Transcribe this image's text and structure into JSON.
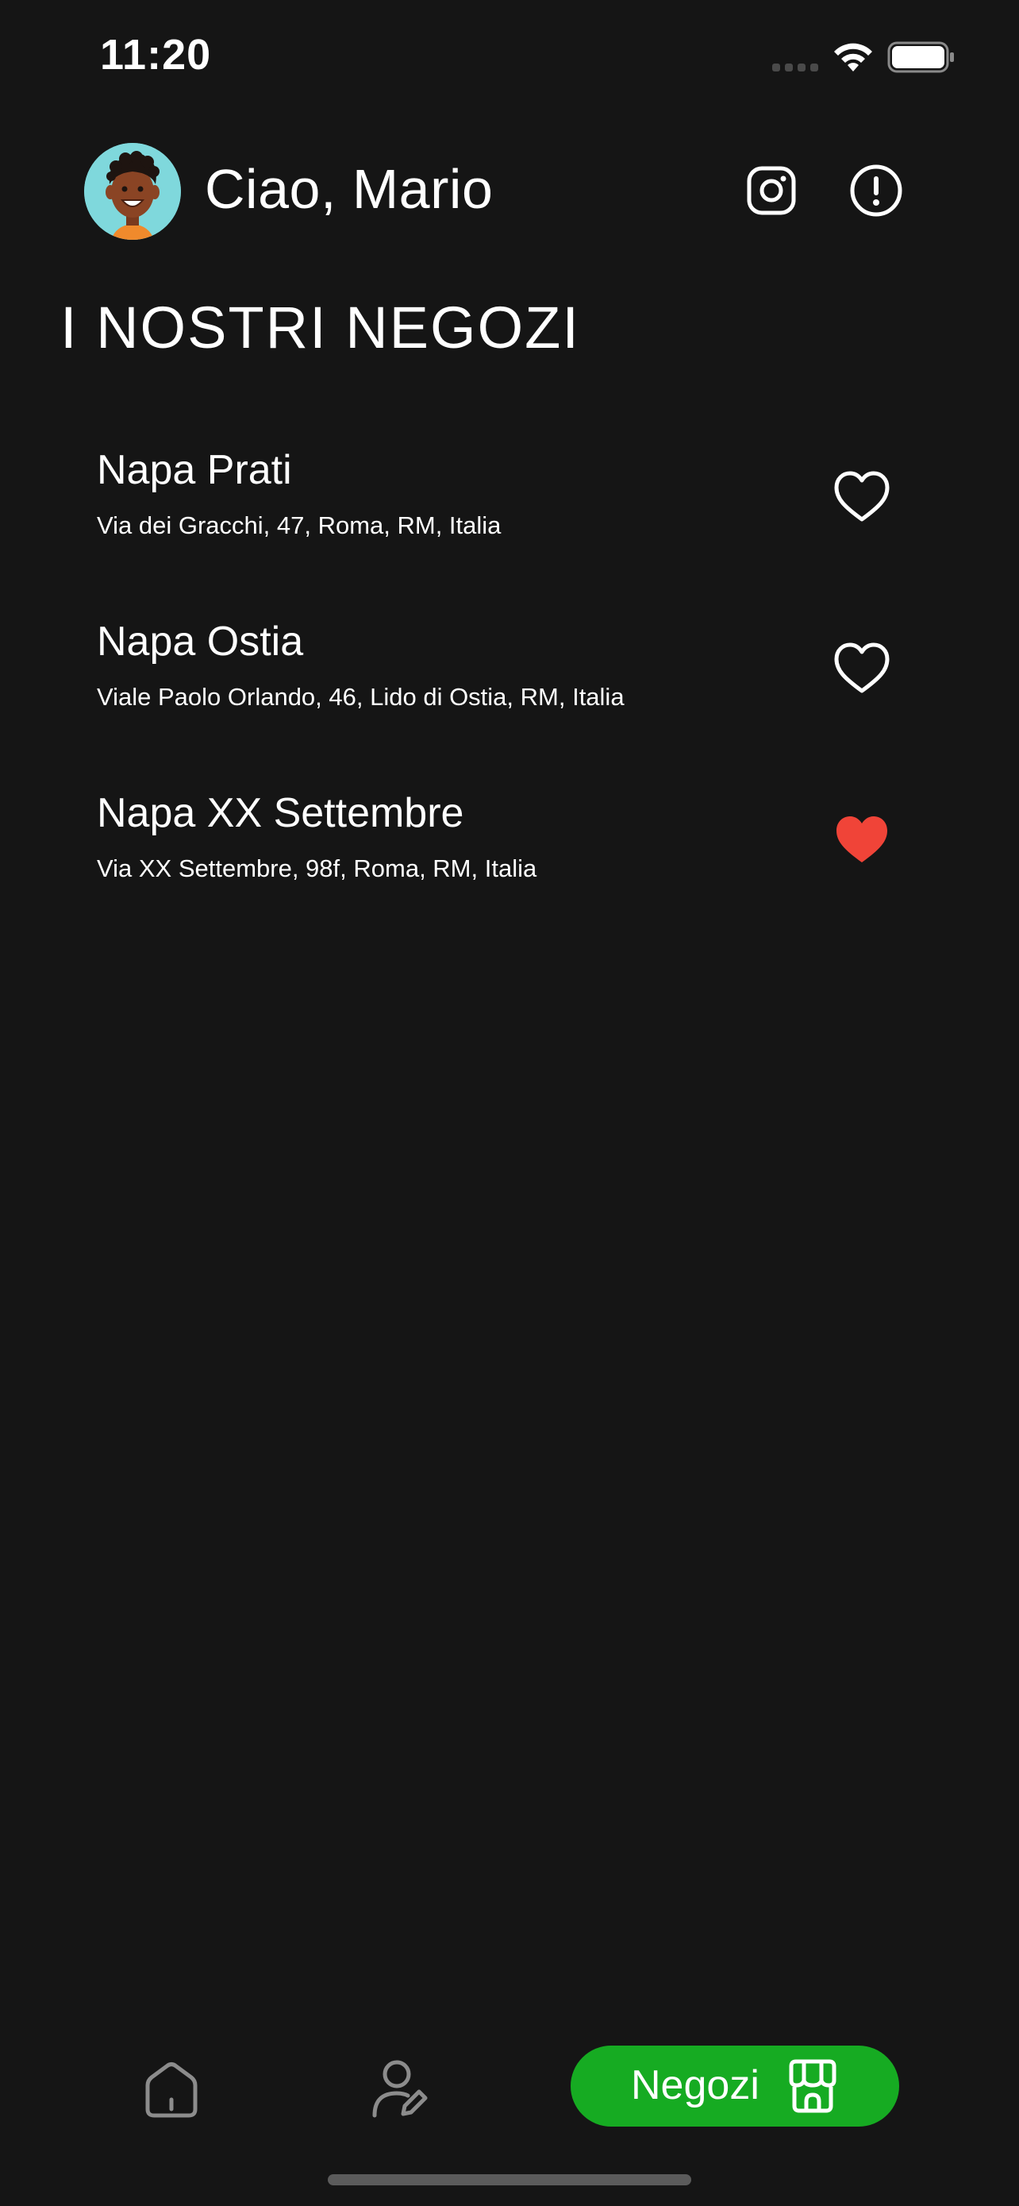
{
  "status_bar": {
    "time": "11:20"
  },
  "header": {
    "greeting": "Ciao, Mario",
    "avatar_icon": "avatar-icon",
    "instagram_icon": "instagram-icon",
    "info_icon": "info-icon"
  },
  "title": "I NOSTRI NEGOZI",
  "stores": [
    {
      "name": "Napa Prati",
      "address": "Via dei Gracchi, 47, Roma, RM, Italia",
      "favorite": false
    },
    {
      "name": "Napa Ostia",
      "address": "Viale Paolo Orlando, 46, Lido di Ostia, RM, Italia",
      "favorite": false
    },
    {
      "name": "Napa XX Settembre",
      "address": "Via XX Settembre, 98f, Roma, RM, Italia",
      "favorite": true
    }
  ],
  "bottom_nav": {
    "home_icon": "home-icon",
    "profile_icon": "profile-edit-icon",
    "stores_label": "Negozi",
    "stores_icon": "store-icon"
  },
  "colors": {
    "background": "#151515",
    "accent_green": "#16ab22",
    "favorite_red": "#f04438",
    "text": "#ffffff"
  }
}
